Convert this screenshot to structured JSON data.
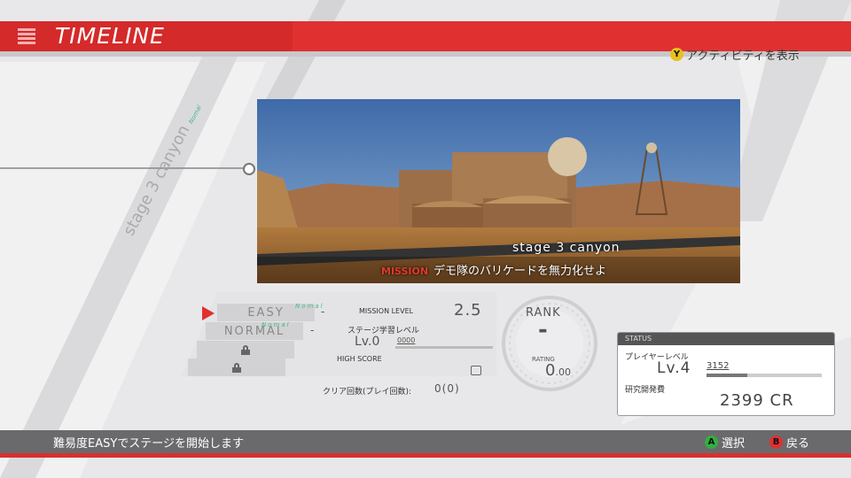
{
  "header": {
    "title": "TIMELINE"
  },
  "activity": {
    "button": "Y",
    "label": "アクティビティを表示"
  },
  "stage": {
    "label": "stage 3  canyon",
    "vertical_label": "stage 3 canyon",
    "vertical_badge": "Nomal",
    "objective_tag": "MISSION",
    "objective": "デモ隊のバリケードを無力化せよ"
  },
  "difficulties": [
    {
      "label": "EASY",
      "badge": "Nomal",
      "dash": "-"
    },
    {
      "label": "NORMAL",
      "badge": "Nomal",
      "dash": "-"
    }
  ],
  "mission": {
    "mission_level_label": "MISSION LEVEL",
    "mission_level_value": "2.5",
    "stage_learn_label": "ステージ学習レベル",
    "stage_learn_value": "Lv.0",
    "stage_learn_sub": "0000",
    "high_score_label": "HIGH SCORE",
    "clear_label": "クリア回数(プレイ回数):",
    "clear_value": "0(0)"
  },
  "rank": {
    "label": "RANK",
    "value": "-",
    "rating_label": "RATING",
    "rating_int": "0",
    "rating_dec": ".00"
  },
  "status": {
    "header": "STATUS",
    "player_level_label": "プレイヤーレベル",
    "player_level_value": "Lv.4",
    "player_level_sub": "3152",
    "player_level_progress": 0.35,
    "research_label": "研究開発費",
    "research_value": "2399 CR"
  },
  "footer": {
    "message": "難易度EASYでステージを開始します",
    "select_button": "A",
    "select_label": "選択",
    "back_button": "B",
    "back_label": "戻る"
  },
  "colors": {
    "accent": "#e03030",
    "button_y": "#e8c020",
    "button_a": "#30b040",
    "button_b": "#e03030"
  }
}
